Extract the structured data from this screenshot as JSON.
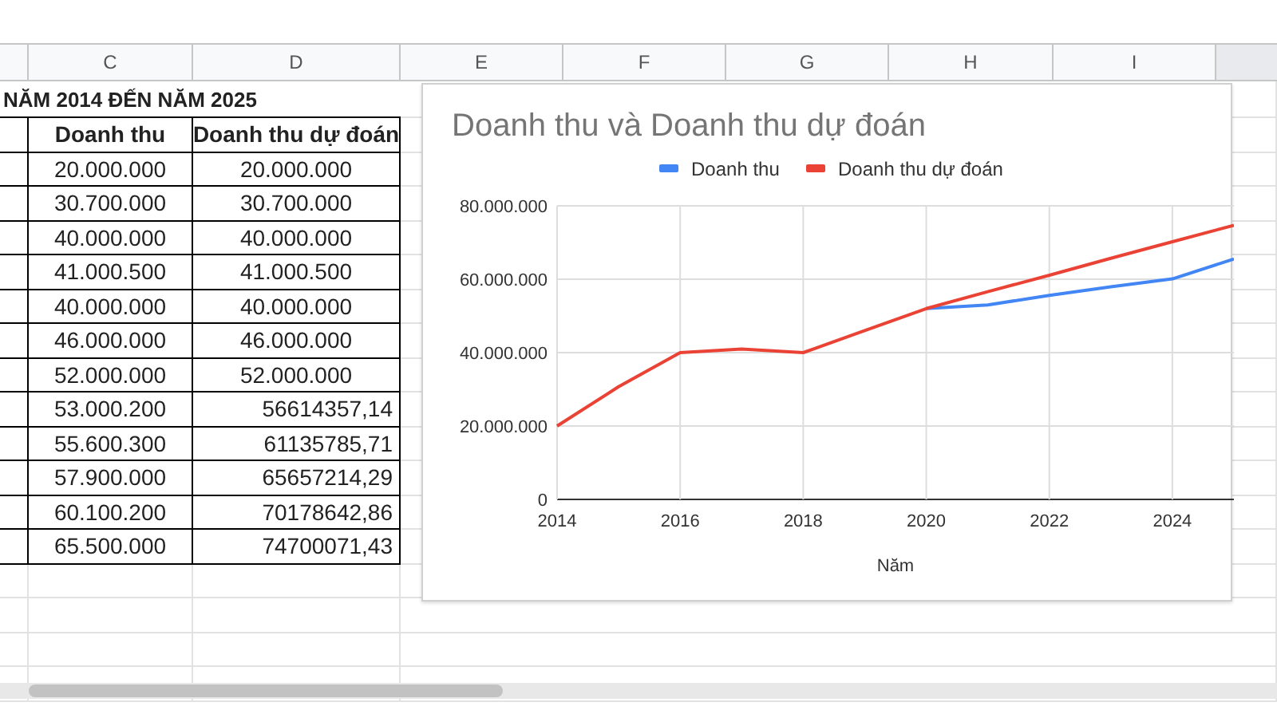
{
  "column_headers": [
    "C",
    "D",
    "E",
    "F",
    "G",
    "H",
    "I"
  ],
  "sheet_title": "NĂM 2014 ĐẾN NĂM 2025",
  "table": {
    "columns": [
      "Doanh thu",
      "Doanh thu dự đoán"
    ],
    "rows": [
      {
        "kind": "text",
        "cells": [
          "20.000.000",
          "20.000.000"
        ]
      },
      {
        "kind": "text",
        "cells": [
          "30.700.000",
          "30.700.000"
        ]
      },
      {
        "kind": "text",
        "cells": [
          "40.000.000",
          "40.000.000"
        ]
      },
      {
        "kind": "text",
        "cells": [
          "41.000.500",
          "41.000.500"
        ]
      },
      {
        "kind": "text",
        "cells": [
          "40.000.000",
          "40.000.000"
        ]
      },
      {
        "kind": "text",
        "cells": [
          "46.000.000",
          "46.000.000"
        ]
      },
      {
        "kind": "text",
        "cells": [
          "52.000.000",
          "52.000.000"
        ]
      },
      {
        "kind": "number",
        "cells": [
          "53.000.200",
          "56614357,14"
        ]
      },
      {
        "kind": "number",
        "cells": [
          "55.600.300",
          "61135785,71"
        ]
      },
      {
        "kind": "number",
        "cells": [
          "57.900.000",
          "65657214,29"
        ]
      },
      {
        "kind": "number",
        "cells": [
          "60.100.200",
          "70178642,86"
        ]
      },
      {
        "kind": "number",
        "cells": [
          "65.500.000",
          "74700071,43"
        ]
      }
    ]
  },
  "chart": {
    "chart_data": {
      "type": "line",
      "title": "Doanh thu và Doanh thu dự đoán",
      "xlabel": "Năm",
      "x": [
        2014,
        2015,
        2016,
        2017,
        2018,
        2019,
        2020,
        2021,
        2022,
        2023,
        2024,
        2025
      ],
      "series": [
        {
          "name": "Doanh thu",
          "color": "#4285f4",
          "values": [
            null,
            null,
            null,
            null,
            null,
            null,
            52000000,
            53000000,
            55600000,
            57900000,
            60100000,
            65500000
          ]
        },
        {
          "name": "Doanh thu dự đoán",
          "color": "#ea4335",
          "values": [
            20000000,
            30700000,
            40000000,
            41000000,
            40000000,
            46000000,
            52000000,
            56600000,
            61100000,
            65700000,
            70200000,
            74700000
          ]
        }
      ],
      "grid": true,
      "legend": "top",
      "xlim": [
        2014,
        2025
      ],
      "ylim": [
        0,
        80000000
      ],
      "xticks": [
        2014,
        2016,
        2018,
        2020,
        2022,
        2024
      ],
      "yticks": [
        {
          "value": 0,
          "label": "0"
        },
        {
          "value": 20000000,
          "label": "20.000.000"
        },
        {
          "value": 40000000,
          "label": "40.000.000"
        },
        {
          "value": 60000000,
          "label": "60.000.000"
        },
        {
          "value": 80000000,
          "label": "80.000.000"
        }
      ]
    }
  }
}
